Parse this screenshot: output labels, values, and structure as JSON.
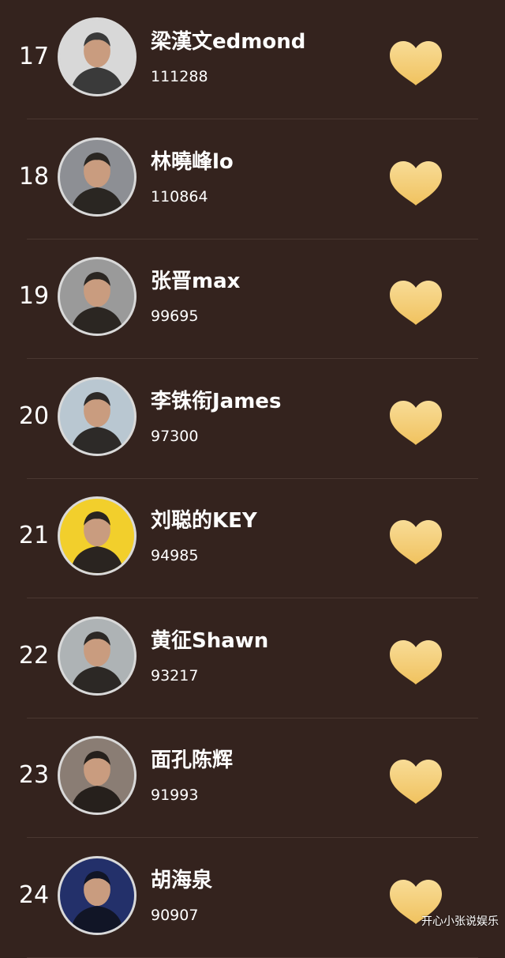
{
  "colors": {
    "background": "#34231e",
    "divider": "#4a3731",
    "heart_top": "#f8dc97",
    "heart_bottom": "#f0c25e",
    "text": "#ffffff"
  },
  "like_icon": "heart-icon",
  "ranking": [
    {
      "rank": "17",
      "name": "梁漢文edmond",
      "score": "111288",
      "avatar_bg": "#d8d8d8",
      "avatar_fg": "#3a3a3a"
    },
    {
      "rank": "18",
      "name": "林曉峰lo",
      "score": "110864",
      "avatar_bg": "#8d8f94",
      "avatar_fg": "#2a2622"
    },
    {
      "rank": "19",
      "name": "张晋max",
      "score": "99695",
      "avatar_bg": "#9a9a9a",
      "avatar_fg": "#2b2622"
    },
    {
      "rank": "20",
      "name": "李铢衔James",
      "score": "97300",
      "avatar_bg": "#b9c7d1",
      "avatar_fg": "#2d2a28"
    },
    {
      "rank": "21",
      "name": "刘聪的KEY",
      "score": "94985",
      "avatar_bg": "#f2cf2c",
      "avatar_fg": "#2a2420"
    },
    {
      "rank": "22",
      "name": "黄征Shawn",
      "score": "93217",
      "avatar_bg": "#aeb3b5",
      "avatar_fg": "#2c2825"
    },
    {
      "rank": "23",
      "name": "面孔陈辉",
      "score": "91993",
      "avatar_bg": "#8a7d74",
      "avatar_fg": "#26201c"
    },
    {
      "rank": "24",
      "name": "胡海泉",
      "score": "90907",
      "avatar_bg": "#23306a",
      "avatar_fg": "#111526"
    }
  ],
  "watermark": "开心小张说娱乐"
}
